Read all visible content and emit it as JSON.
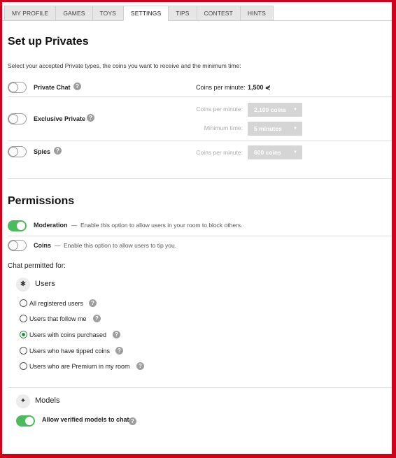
{
  "tabs": [
    {
      "label": "MY PROFILE"
    },
    {
      "label": "GAMES"
    },
    {
      "label": "TOYS"
    },
    {
      "label": "SETTINGS"
    },
    {
      "label": "TIPS"
    },
    {
      "label": "CONTEST"
    },
    {
      "label": "HINTS"
    }
  ],
  "privates": {
    "title": "Set up Privates",
    "description": "Select your accepted Private types, the coins you want to receive and the minimum time:",
    "private_chat": {
      "label": "Private Chat",
      "coins_label": "Coins per minute:",
      "coins_value": "1,500 ⋞"
    },
    "exclusive": {
      "label": "Exclusive Private",
      "coins_label": "Coins per minute:",
      "coins_value": "2,100 coins",
      "time_label": "Minimum time:",
      "time_value": "5 minutes"
    },
    "spies": {
      "label": "Spies",
      "coins_label": "Coins per minute:",
      "coins_value": "600 coins"
    }
  },
  "permissions": {
    "title": "Permissions",
    "moderation": {
      "label": "Moderation",
      "dash": "—",
      "desc": "Enable this option to allow users in your room to block others."
    },
    "coins": {
      "label": "Coins",
      "dash": "—",
      "desc": "Enable this option to allow users to tip you."
    },
    "chat_permitted": "Chat permitted for:",
    "users_heading": "Users",
    "options": [
      {
        "label": "All registered users"
      },
      {
        "label": "Users that follow me"
      },
      {
        "label": "Users with coins purchased"
      },
      {
        "label": "Users who have tipped coins"
      },
      {
        "label": "Users who are Premium in my room"
      }
    ],
    "models_heading": "Models",
    "models_toggle": "Allow verified models to chat"
  },
  "icons": {
    "help": "?",
    "users": "✱",
    "models": "✦"
  },
  "colors": {
    "frame": "#d0021b",
    "toggle_on": "#4cbb5d",
    "radio_checked": "#3a8a47"
  }
}
